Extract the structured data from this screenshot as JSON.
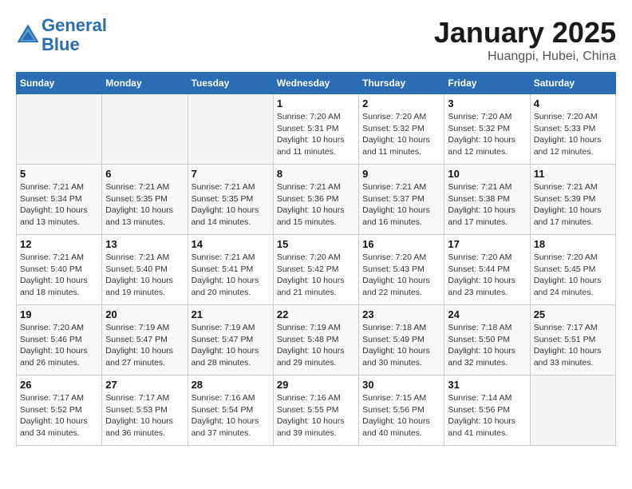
{
  "header": {
    "logo_line1": "General",
    "logo_line2": "Blue",
    "title": "January 2025",
    "subtitle": "Huangpi, Hubei, China"
  },
  "days_of_week": [
    "Sunday",
    "Monday",
    "Tuesday",
    "Wednesday",
    "Thursday",
    "Friday",
    "Saturday"
  ],
  "weeks": [
    [
      {
        "day": "",
        "info": ""
      },
      {
        "day": "",
        "info": ""
      },
      {
        "day": "",
        "info": ""
      },
      {
        "day": "1",
        "info": "Sunrise: 7:20 AM\nSunset: 5:31 PM\nDaylight: 10 hours\nand 11 minutes."
      },
      {
        "day": "2",
        "info": "Sunrise: 7:20 AM\nSunset: 5:32 PM\nDaylight: 10 hours\nand 11 minutes."
      },
      {
        "day": "3",
        "info": "Sunrise: 7:20 AM\nSunset: 5:32 PM\nDaylight: 10 hours\nand 12 minutes."
      },
      {
        "day": "4",
        "info": "Sunrise: 7:20 AM\nSunset: 5:33 PM\nDaylight: 10 hours\nand 12 minutes."
      }
    ],
    [
      {
        "day": "5",
        "info": "Sunrise: 7:21 AM\nSunset: 5:34 PM\nDaylight: 10 hours\nand 13 minutes."
      },
      {
        "day": "6",
        "info": "Sunrise: 7:21 AM\nSunset: 5:35 PM\nDaylight: 10 hours\nand 13 minutes."
      },
      {
        "day": "7",
        "info": "Sunrise: 7:21 AM\nSunset: 5:35 PM\nDaylight: 10 hours\nand 14 minutes."
      },
      {
        "day": "8",
        "info": "Sunrise: 7:21 AM\nSunset: 5:36 PM\nDaylight: 10 hours\nand 15 minutes."
      },
      {
        "day": "9",
        "info": "Sunrise: 7:21 AM\nSunset: 5:37 PM\nDaylight: 10 hours\nand 16 minutes."
      },
      {
        "day": "10",
        "info": "Sunrise: 7:21 AM\nSunset: 5:38 PM\nDaylight: 10 hours\nand 17 minutes."
      },
      {
        "day": "11",
        "info": "Sunrise: 7:21 AM\nSunset: 5:39 PM\nDaylight: 10 hours\nand 17 minutes."
      }
    ],
    [
      {
        "day": "12",
        "info": "Sunrise: 7:21 AM\nSunset: 5:40 PM\nDaylight: 10 hours\nand 18 minutes."
      },
      {
        "day": "13",
        "info": "Sunrise: 7:21 AM\nSunset: 5:40 PM\nDaylight: 10 hours\nand 19 minutes."
      },
      {
        "day": "14",
        "info": "Sunrise: 7:21 AM\nSunset: 5:41 PM\nDaylight: 10 hours\nand 20 minutes."
      },
      {
        "day": "15",
        "info": "Sunrise: 7:20 AM\nSunset: 5:42 PM\nDaylight: 10 hours\nand 21 minutes."
      },
      {
        "day": "16",
        "info": "Sunrise: 7:20 AM\nSunset: 5:43 PM\nDaylight: 10 hours\nand 22 minutes."
      },
      {
        "day": "17",
        "info": "Sunrise: 7:20 AM\nSunset: 5:44 PM\nDaylight: 10 hours\nand 23 minutes."
      },
      {
        "day": "18",
        "info": "Sunrise: 7:20 AM\nSunset: 5:45 PM\nDaylight: 10 hours\nand 24 minutes."
      }
    ],
    [
      {
        "day": "19",
        "info": "Sunrise: 7:20 AM\nSunset: 5:46 PM\nDaylight: 10 hours\nand 26 minutes."
      },
      {
        "day": "20",
        "info": "Sunrise: 7:19 AM\nSunset: 5:47 PM\nDaylight: 10 hours\nand 27 minutes."
      },
      {
        "day": "21",
        "info": "Sunrise: 7:19 AM\nSunset: 5:47 PM\nDaylight: 10 hours\nand 28 minutes."
      },
      {
        "day": "22",
        "info": "Sunrise: 7:19 AM\nSunset: 5:48 PM\nDaylight: 10 hours\nand 29 minutes."
      },
      {
        "day": "23",
        "info": "Sunrise: 7:18 AM\nSunset: 5:49 PM\nDaylight: 10 hours\nand 30 minutes."
      },
      {
        "day": "24",
        "info": "Sunrise: 7:18 AM\nSunset: 5:50 PM\nDaylight: 10 hours\nand 32 minutes."
      },
      {
        "day": "25",
        "info": "Sunrise: 7:17 AM\nSunset: 5:51 PM\nDaylight: 10 hours\nand 33 minutes."
      }
    ],
    [
      {
        "day": "26",
        "info": "Sunrise: 7:17 AM\nSunset: 5:52 PM\nDaylight: 10 hours\nand 34 minutes."
      },
      {
        "day": "27",
        "info": "Sunrise: 7:17 AM\nSunset: 5:53 PM\nDaylight: 10 hours\nand 36 minutes."
      },
      {
        "day": "28",
        "info": "Sunrise: 7:16 AM\nSunset: 5:54 PM\nDaylight: 10 hours\nand 37 minutes."
      },
      {
        "day": "29",
        "info": "Sunrise: 7:16 AM\nSunset: 5:55 PM\nDaylight: 10 hours\nand 39 minutes."
      },
      {
        "day": "30",
        "info": "Sunrise: 7:15 AM\nSunset: 5:56 PM\nDaylight: 10 hours\nand 40 minutes."
      },
      {
        "day": "31",
        "info": "Sunrise: 7:14 AM\nSunset: 5:56 PM\nDaylight: 10 hours\nand 41 minutes."
      },
      {
        "day": "",
        "info": ""
      }
    ]
  ]
}
